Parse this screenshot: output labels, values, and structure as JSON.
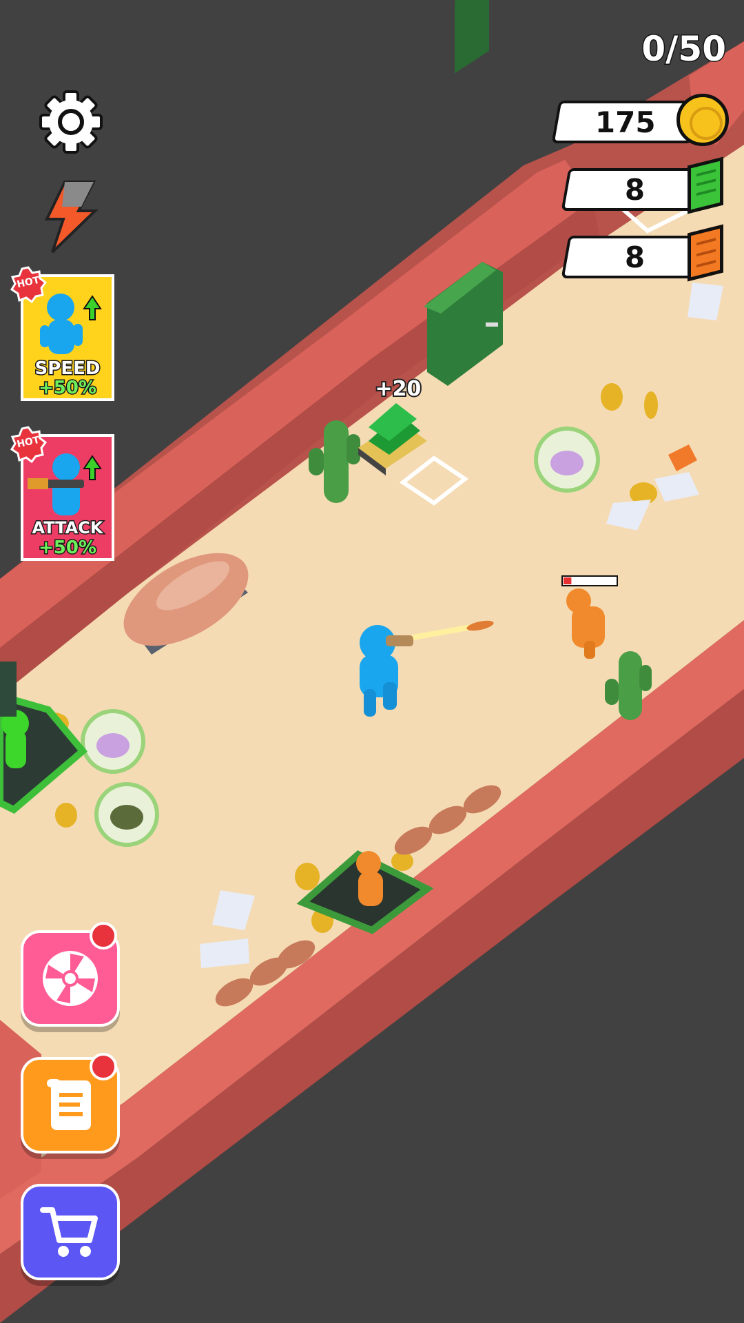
{
  "hud": {
    "capacity": "0/50",
    "coins": "175",
    "green_cash": "8",
    "orange_bricks": "8",
    "float_reward": "+20",
    "enemy_health_fraction": 0.15
  },
  "boosts": {
    "speed": {
      "badge": "HOT",
      "name": "SPEED",
      "bonus": "+50%"
    },
    "attack": {
      "badge": "HOT",
      "name": "ATTACK",
      "bonus": "+50%"
    }
  },
  "icons": {
    "settings": "gear-icon",
    "energy": "lightning-icon",
    "spin": "wheel-icon",
    "quests": "scroll-icon",
    "shop": "cart-icon",
    "coin": "coin-icon",
    "cash": "cash-stack-icon",
    "brick": "brick-icon"
  },
  "colors": {
    "background": "#414141",
    "cliff": "#d9625a",
    "sand": "#f5dbb4",
    "player": "#1aa6ee",
    "enemy": "#f08a2c",
    "ally": "#3dd62a",
    "speed_card": "#ffd21c",
    "attack_card": "#ee3d64",
    "spin_button": "#ff5b95",
    "quest_button": "#ff9a1c",
    "shop_button": "#5c56f5"
  }
}
